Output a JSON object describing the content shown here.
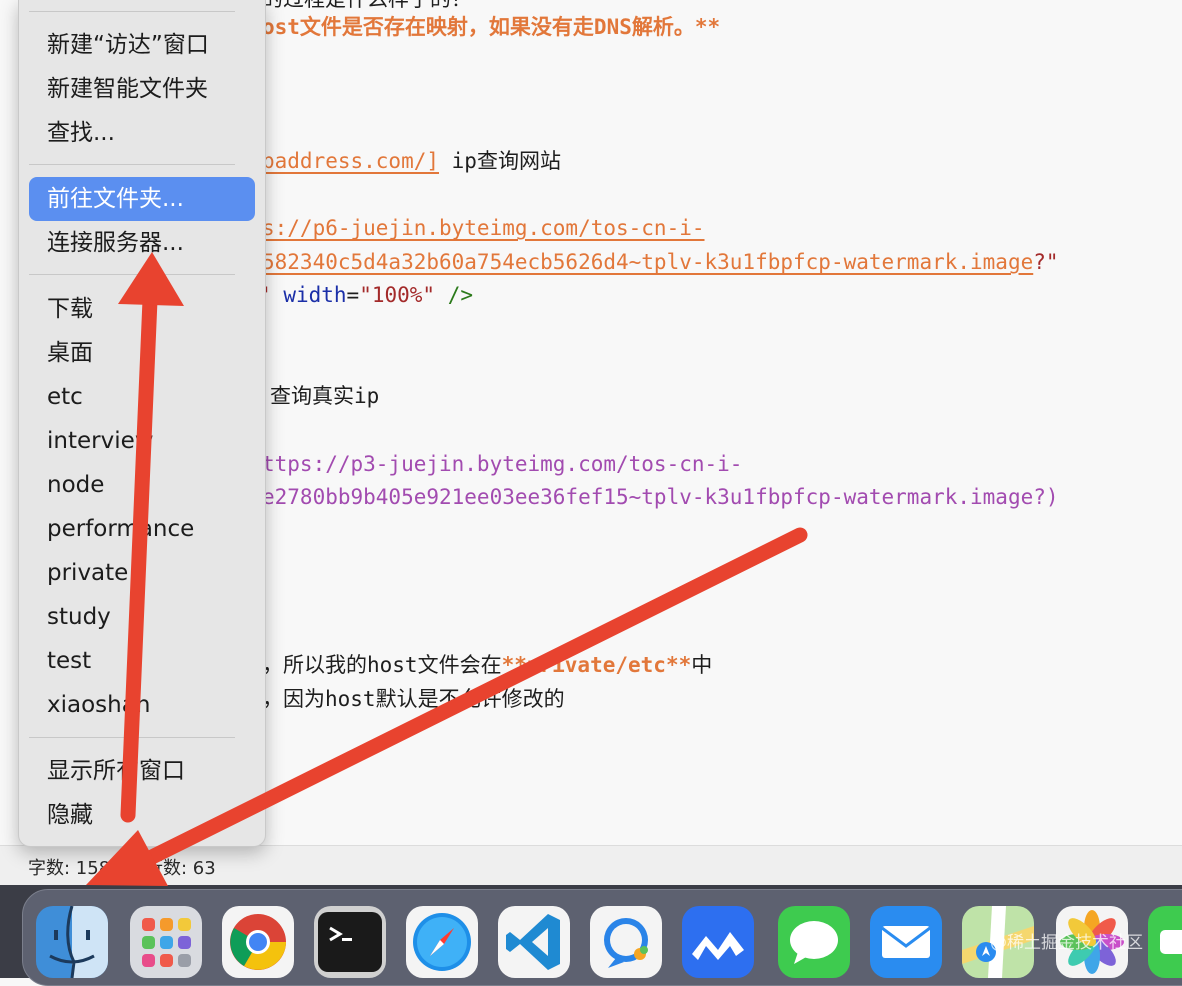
{
  "editor": {
    "lines": {
      "l0": {
        "text": "的过程是什么样子的？"
      },
      "l1": {
        "text": "ost文件是否存在映射，如果没有走DNS解析。**"
      },
      "l2": {
        "link": "paddress.com/]",
        "text": " ip查询网站"
      },
      "l3": {
        "link": "s://p6-juejin.byteimg.com/tos-cn-i-"
      },
      "l4": {
        "link": "582340c5d4a32b60a754ecb5626d4~tplv-k3u1fbpfcp-watermark.image",
        "tail": "?\""
      },
      "l5": {
        "q": "\"",
        "attr": "width",
        "eq": "=",
        "val": "\"100%\"",
        "close": " />"
      },
      "l6": {
        "text": "查询真实ip"
      },
      "l7": {
        "text": "ttps://p3-juejin.byteimg.com/tos-cn-i-"
      },
      "l8": {
        "text": "e2780bb9b405e921ee03ee36fef15~tplv-k3u1fbpfcp-watermark.image?)"
      },
      "l9": {
        "pre": "，所以我的host文件会在",
        "bold": "**private/etc**",
        "post": "中"
      },
      "l10": {
        "text": "，因为host默认是不允许修改的"
      }
    }
  },
  "statusbar": {
    "words": "字数: 1584",
    "lines_count": "行数: 63"
  },
  "menu": {
    "items": [
      {
        "label": "新建“访达”窗口"
      },
      {
        "label": "新建智能文件夹"
      },
      {
        "label": "查找..."
      },
      {
        "label": "前往文件夹...",
        "active": true
      },
      {
        "label": "连接服务器..."
      },
      {
        "label": "下载"
      },
      {
        "label": "桌面"
      },
      {
        "label": "etc"
      },
      {
        "label": "interview"
      },
      {
        "label": "node"
      },
      {
        "label": "performance"
      },
      {
        "label": "private"
      },
      {
        "label": "study"
      },
      {
        "label": "test"
      },
      {
        "label": "xiaoshan"
      },
      {
        "label": "显示所有窗口"
      },
      {
        "label": "隐藏"
      }
    ]
  },
  "dock": {
    "apps": [
      {
        "name": "finder-icon"
      },
      {
        "name": "launchpad-icon"
      },
      {
        "name": "chrome-icon"
      },
      {
        "name": "terminal-icon"
      },
      {
        "name": "safari-icon"
      },
      {
        "name": "vscode-icon"
      },
      {
        "name": "chat-app-icon"
      },
      {
        "name": "lark-icon"
      },
      {
        "name": "messages-icon"
      },
      {
        "name": "mail-icon"
      },
      {
        "name": "maps-icon"
      },
      {
        "name": "photos-icon"
      },
      {
        "name": "facetime-icon"
      }
    ]
  },
  "watermark": "@稀土掘金技术社区",
  "colors": {
    "accent": "#5b8ff0",
    "link": "#e2773a",
    "purple": "#a24bb0",
    "arrow": "#e8432f"
  }
}
